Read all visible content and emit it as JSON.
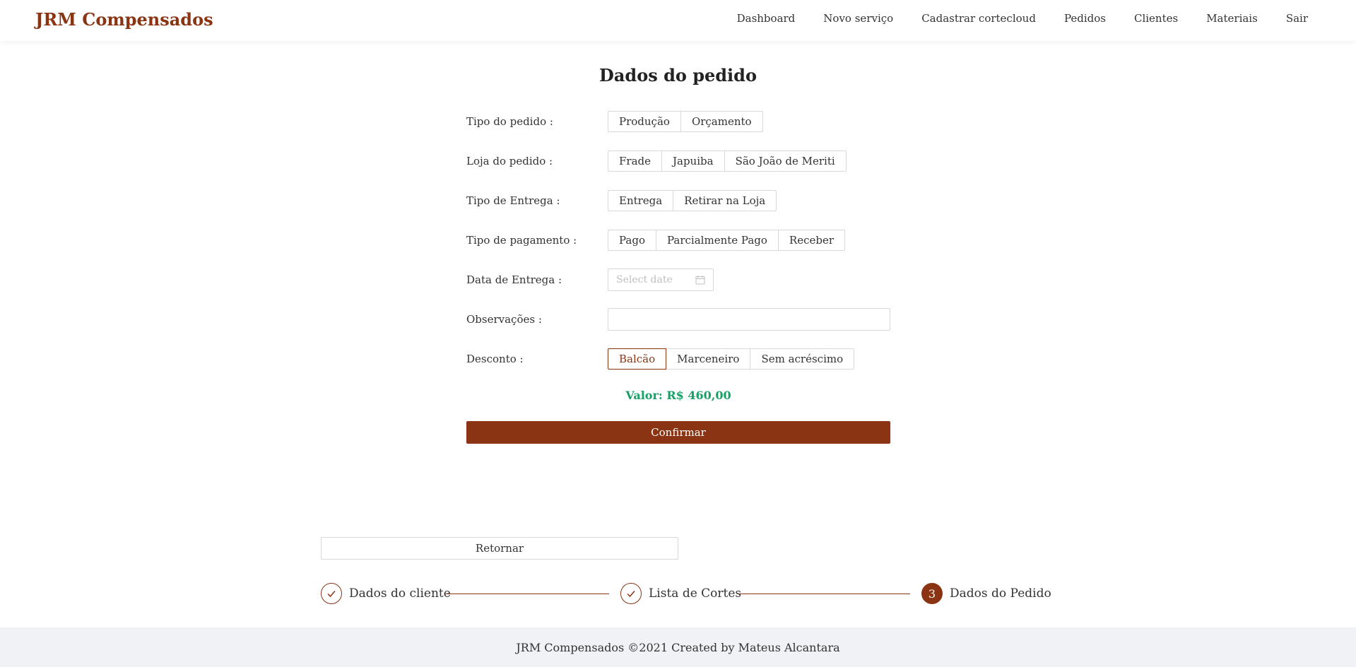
{
  "brand": "JRM Compensados",
  "nav": [
    "Dashboard",
    "Novo serviço",
    "Cadastrar cortecloud",
    "Pedidos",
    "Clientes",
    "Materiais",
    "Sair"
  ],
  "form": {
    "title": "Dados do pedido",
    "tipo_pedido": {
      "label": "Tipo do pedido",
      "options": [
        "Produção",
        "Orçamento"
      ]
    },
    "loja": {
      "label": "Loja do pedido",
      "options": [
        "Frade",
        "Japuiba",
        "São João de Meriti"
      ]
    },
    "entrega": {
      "label": "Tipo de Entrega",
      "options": [
        "Entrega",
        "Retirar na Loja"
      ]
    },
    "pagamento": {
      "label": "Tipo de pagamento",
      "options": [
        "Pago",
        "Parcialmente Pago",
        "Receber"
      ]
    },
    "data_entrega": {
      "label": "Data de Entrega",
      "placeholder": "Select date"
    },
    "observacoes": {
      "label": "Observações",
      "value": ""
    },
    "desconto": {
      "label": "Desconto",
      "options": [
        "Balcão",
        "Marceneiro",
        "Sem acréscimo"
      ],
      "selected": "Balcão"
    },
    "valor": "Valor: R$ 460,00",
    "confirm_label": "Confirmar"
  },
  "back_label": "Retornar",
  "steps": [
    {
      "title": "Dados do cliente",
      "status": "done"
    },
    {
      "title": "Lista de Cortes",
      "status": "done"
    },
    {
      "title": "Dados do Pedido",
      "status": "current",
      "number": "3"
    }
  ],
  "footer": "JRM Compensados ©2021 Created by Mateus Alcantara",
  "colors": {
    "accent": "#8a3413",
    "valor": "#16a065",
    "footer_bg": "#f0f2f5"
  }
}
